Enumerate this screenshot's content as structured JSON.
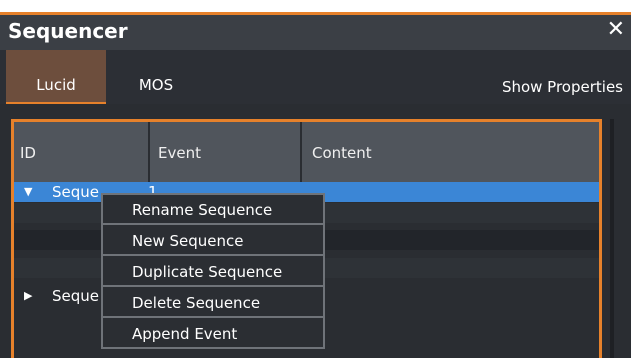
{
  "window": {
    "title": "Sequencer"
  },
  "tabs": [
    {
      "label": "Lucid",
      "active": true
    },
    {
      "label": "MOS",
      "active": false
    }
  ],
  "toolbar": {
    "show_properties": "Show Properties"
  },
  "table": {
    "columns": [
      "ID",
      "Event",
      "Content"
    ],
    "rows": [
      {
        "label": "Seque",
        "expanded": true,
        "selected": true,
        "suffix": "1"
      },
      {
        "label": "Seque",
        "expanded": false,
        "selected": false
      }
    ]
  },
  "context_menu": {
    "items": [
      "Rename Sequence",
      "New Sequence",
      "Duplicate Sequence",
      "Delete Sequence",
      "Append Event"
    ]
  },
  "colors": {
    "accent": "#e6812b",
    "selection": "#3b86d6",
    "tab_active": "#6d4e3d"
  }
}
